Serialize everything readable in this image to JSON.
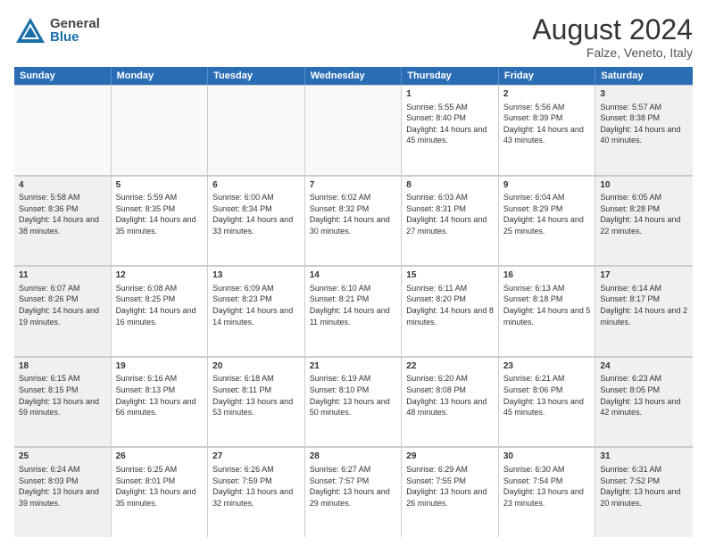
{
  "header": {
    "logo": {
      "line1": "General",
      "line2": "Blue"
    },
    "title": "August 2024",
    "location": "Falze, Veneto, Italy"
  },
  "days": [
    "Sunday",
    "Monday",
    "Tuesday",
    "Wednesday",
    "Thursday",
    "Friday",
    "Saturday"
  ],
  "rows": [
    [
      {
        "day": "",
        "info": "",
        "empty": true
      },
      {
        "day": "",
        "info": "",
        "empty": true
      },
      {
        "day": "",
        "info": "",
        "empty": true
      },
      {
        "day": "",
        "info": "",
        "empty": true
      },
      {
        "day": "1",
        "info": "Sunrise: 5:55 AM\nSunset: 8:40 PM\nDaylight: 14 hours\nand 45 minutes."
      },
      {
        "day": "2",
        "info": "Sunrise: 5:56 AM\nSunset: 8:39 PM\nDaylight: 14 hours\nand 43 minutes."
      },
      {
        "day": "3",
        "info": "Sunrise: 5:57 AM\nSunset: 8:38 PM\nDaylight: 14 hours\nand 40 minutes.",
        "shaded": true
      }
    ],
    [
      {
        "day": "4",
        "info": "Sunrise: 5:58 AM\nSunset: 8:36 PM\nDaylight: 14 hours\nand 38 minutes.",
        "shaded": true
      },
      {
        "day": "5",
        "info": "Sunrise: 5:59 AM\nSunset: 8:35 PM\nDaylight: 14 hours\nand 35 minutes."
      },
      {
        "day": "6",
        "info": "Sunrise: 6:00 AM\nSunset: 8:34 PM\nDaylight: 14 hours\nand 33 minutes."
      },
      {
        "day": "7",
        "info": "Sunrise: 6:02 AM\nSunset: 8:32 PM\nDaylight: 14 hours\nand 30 minutes."
      },
      {
        "day": "8",
        "info": "Sunrise: 6:03 AM\nSunset: 8:31 PM\nDaylight: 14 hours\nand 27 minutes."
      },
      {
        "day": "9",
        "info": "Sunrise: 6:04 AM\nSunset: 8:29 PM\nDaylight: 14 hours\nand 25 minutes."
      },
      {
        "day": "10",
        "info": "Sunrise: 6:05 AM\nSunset: 8:28 PM\nDaylight: 14 hours\nand 22 minutes.",
        "shaded": true
      }
    ],
    [
      {
        "day": "11",
        "info": "Sunrise: 6:07 AM\nSunset: 8:26 PM\nDaylight: 14 hours\nand 19 minutes.",
        "shaded": true
      },
      {
        "day": "12",
        "info": "Sunrise: 6:08 AM\nSunset: 8:25 PM\nDaylight: 14 hours\nand 16 minutes."
      },
      {
        "day": "13",
        "info": "Sunrise: 6:09 AM\nSunset: 8:23 PM\nDaylight: 14 hours\nand 14 minutes."
      },
      {
        "day": "14",
        "info": "Sunrise: 6:10 AM\nSunset: 8:21 PM\nDaylight: 14 hours\nand 11 minutes."
      },
      {
        "day": "15",
        "info": "Sunrise: 6:11 AM\nSunset: 8:20 PM\nDaylight: 14 hours\nand 8 minutes."
      },
      {
        "day": "16",
        "info": "Sunrise: 6:13 AM\nSunset: 8:18 PM\nDaylight: 14 hours\nand 5 minutes."
      },
      {
        "day": "17",
        "info": "Sunrise: 6:14 AM\nSunset: 8:17 PM\nDaylight: 14 hours\nand 2 minutes.",
        "shaded": true
      }
    ],
    [
      {
        "day": "18",
        "info": "Sunrise: 6:15 AM\nSunset: 8:15 PM\nDaylight: 13 hours\nand 59 minutes.",
        "shaded": true
      },
      {
        "day": "19",
        "info": "Sunrise: 6:16 AM\nSunset: 8:13 PM\nDaylight: 13 hours\nand 56 minutes."
      },
      {
        "day": "20",
        "info": "Sunrise: 6:18 AM\nSunset: 8:11 PM\nDaylight: 13 hours\nand 53 minutes."
      },
      {
        "day": "21",
        "info": "Sunrise: 6:19 AM\nSunset: 8:10 PM\nDaylight: 13 hours\nand 50 minutes."
      },
      {
        "day": "22",
        "info": "Sunrise: 6:20 AM\nSunset: 8:08 PM\nDaylight: 13 hours\nand 48 minutes."
      },
      {
        "day": "23",
        "info": "Sunrise: 6:21 AM\nSunset: 8:06 PM\nDaylight: 13 hours\nand 45 minutes."
      },
      {
        "day": "24",
        "info": "Sunrise: 6:23 AM\nSunset: 8:05 PM\nDaylight: 13 hours\nand 42 minutes.",
        "shaded": true
      }
    ],
    [
      {
        "day": "25",
        "info": "Sunrise: 6:24 AM\nSunset: 8:03 PM\nDaylight: 13 hours\nand 39 minutes.",
        "shaded": true
      },
      {
        "day": "26",
        "info": "Sunrise: 6:25 AM\nSunset: 8:01 PM\nDaylight: 13 hours\nand 35 minutes."
      },
      {
        "day": "27",
        "info": "Sunrise: 6:26 AM\nSunset: 7:59 PM\nDaylight: 13 hours\nand 32 minutes."
      },
      {
        "day": "28",
        "info": "Sunrise: 6:27 AM\nSunset: 7:57 PM\nDaylight: 13 hours\nand 29 minutes."
      },
      {
        "day": "29",
        "info": "Sunrise: 6:29 AM\nSunset: 7:55 PM\nDaylight: 13 hours\nand 26 minutes."
      },
      {
        "day": "30",
        "info": "Sunrise: 6:30 AM\nSunset: 7:54 PM\nDaylight: 13 hours\nand 23 minutes."
      },
      {
        "day": "31",
        "info": "Sunrise: 6:31 AM\nSunset: 7:52 PM\nDaylight: 13 hours\nand 20 minutes.",
        "shaded": true
      }
    ]
  ]
}
